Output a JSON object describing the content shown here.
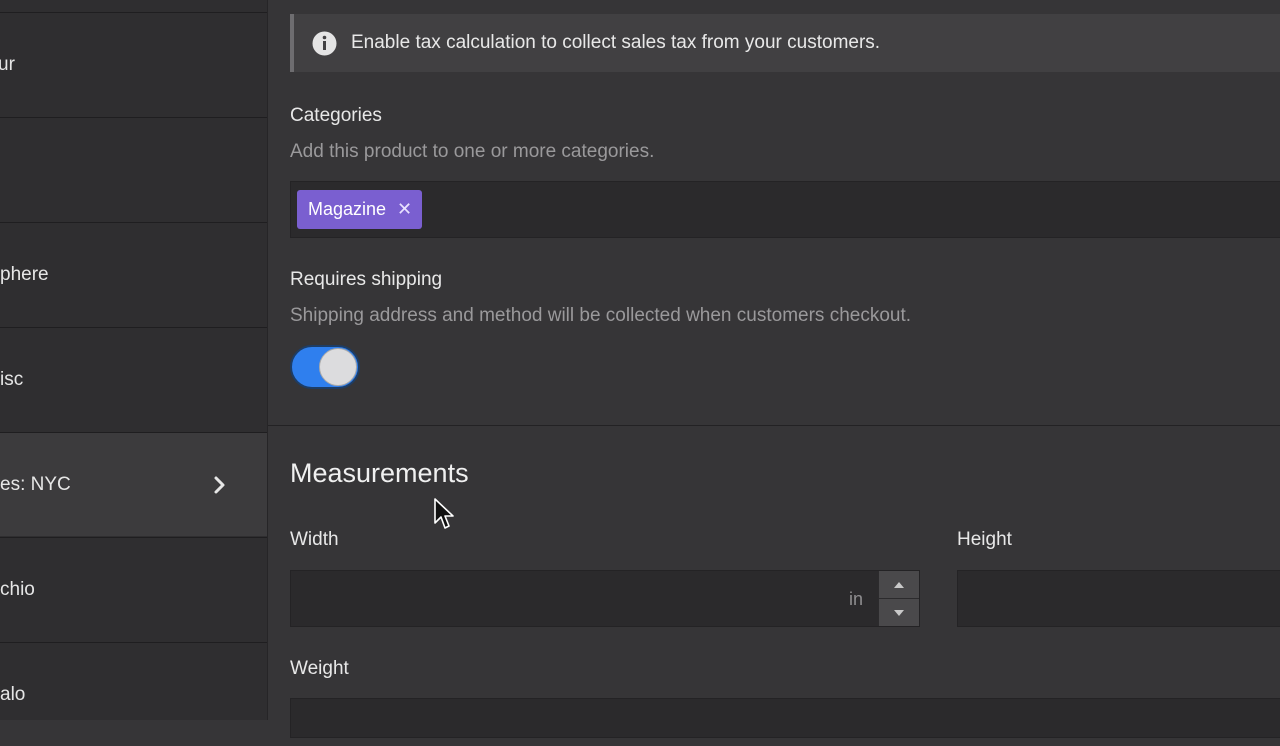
{
  "sidebar": {
    "items": [
      {
        "label": "ur"
      },
      {
        "label": ""
      },
      {
        "label": "phere"
      },
      {
        "label": "isc"
      },
      {
        "label": "es: NYC"
      },
      {
        "label": "chio"
      },
      {
        "label": "alo"
      }
    ]
  },
  "notice": {
    "text": "Enable tax calculation to collect sales tax from your customers.",
    "icon": "info-icon"
  },
  "categories": {
    "label": "Categories",
    "help": "Add this product to one or more categories.",
    "tags": [
      {
        "label": "Magazine",
        "remove": "✕"
      }
    ],
    "tag_color": "#7a5fd0"
  },
  "shipping": {
    "label": "Requires shipping",
    "help": "Shipping address and method will be collected when customers checkout.",
    "enabled": true,
    "toggle_color": "#2f7fee"
  },
  "measurements": {
    "title": "Measurements",
    "width": {
      "label": "Width",
      "value": "",
      "unit": "in"
    },
    "height": {
      "label": "Height",
      "value": ""
    },
    "weight": {
      "label": "Weight"
    }
  }
}
